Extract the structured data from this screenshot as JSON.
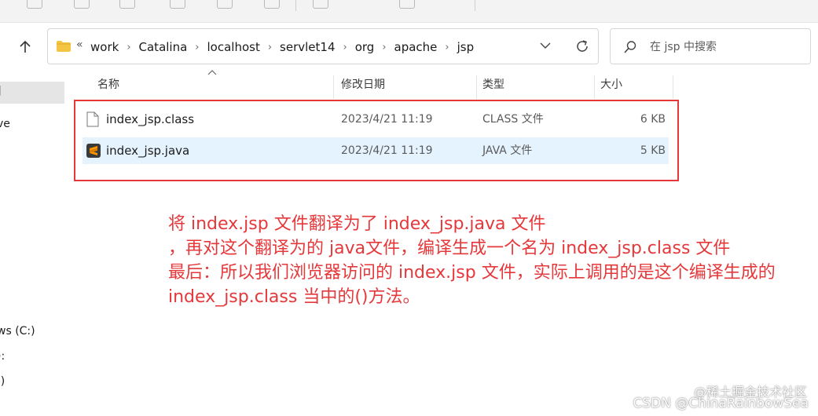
{
  "address": {
    "overflow": "«",
    "breadcrumbs": [
      "work",
      "Catalina",
      "localhost",
      "servlet14",
      "org",
      "apache",
      "jsp"
    ]
  },
  "search": {
    "placeholder": "在 jsp 中搜索"
  },
  "nav_pane": {
    "items": [
      "]",
      "ve",
      "ws (C:)",
      "):",
      ":)"
    ]
  },
  "columns": {
    "name": "名称",
    "modified": "修改日期",
    "type": "类型",
    "size": "大小"
  },
  "files": [
    {
      "name": "index_jsp.class",
      "modified": "2023/4/21 11:19",
      "type": "CLASS 文件",
      "size": "6 KB",
      "icon": "file-icon"
    },
    {
      "name": "index_jsp.java",
      "modified": "2023/4/21 11:19",
      "type": "JAVA 文件",
      "size": "5 KB",
      "icon": "sublime-text-icon",
      "selected": true
    }
  ],
  "annotation": {
    "lines": [
      "将 index.jsp 文件翻译为了  index_jsp.java 文件",
      "，再对这个翻译为的 java文件，编译生成一个名为 index_jsp.class 文件",
      "最后：所以我们浏览器访问的 index.jsp 文件，实际上调用的是这个编译生成的",
      "index_jsp.class 当中的()方法。"
    ],
    "color": "#e5383b"
  },
  "watermark": "CSDN @ChinaRainbowSea",
  "watermark_top": "@稀土掘金技术社区",
  "colors": {
    "selection": "#e5f3ff",
    "highlight": "#e5383b",
    "folder": "#f4c542"
  }
}
